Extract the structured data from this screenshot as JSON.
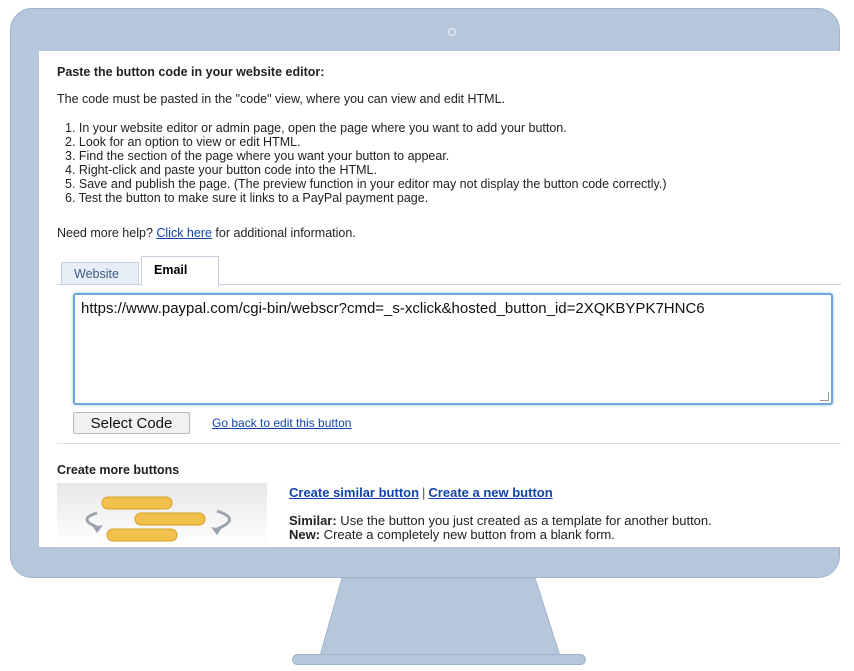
{
  "page": {
    "heading": "Paste the button code in your website editor:",
    "intro": "The code must be pasted in the \"code\" view, where you can view and edit HTML.",
    "steps": [
      "1. In your website editor or admin page, open the page where you want to add your button.",
      "2. Look for an option to view or edit HTML.",
      "3. Find the section of the page where you want your button to appear.",
      "4. Right-click and paste your button code into the HTML.",
      "5. Save and publish the page. (The preview function in your editor may not display the button code correctly.)",
      "6. Test the button to make sure it links to a PayPal payment page."
    ],
    "help": {
      "prefix": "Need more help? ",
      "link": "Click here",
      "suffix": " for additional information."
    },
    "tabs": [
      {
        "label": "Website",
        "active": false
      },
      {
        "label": "Email",
        "active": true
      }
    ],
    "code_value": "https://www.paypal.com/cgi-bin/webscr?cmd=_s-xclick&hosted_button_id=2XQKBYPK7HNC6",
    "select_code_label": "Select Code",
    "go_back_label": "Go back to edit this button",
    "create_heading": "Create more buttons",
    "create_similar_link": "Create similar button",
    "link_separator": "|",
    "create_new_link": "Create a new button",
    "similar_label": "Similar:",
    "similar_text": " Use the button you just created as a template for another button.",
    "new_label": "New:",
    "new_text": " Create a completely new button from a blank form."
  },
  "colors": {
    "monitor_frame": "#b6c7dc",
    "link": "#1144aa",
    "focus_border": "#6fa7e0",
    "tab_inactive_bg": "#e8eef7"
  },
  "icons": {
    "camera": "monitor-camera-icon",
    "create_buttons_illustration": "buttons-arrows-illustration"
  }
}
